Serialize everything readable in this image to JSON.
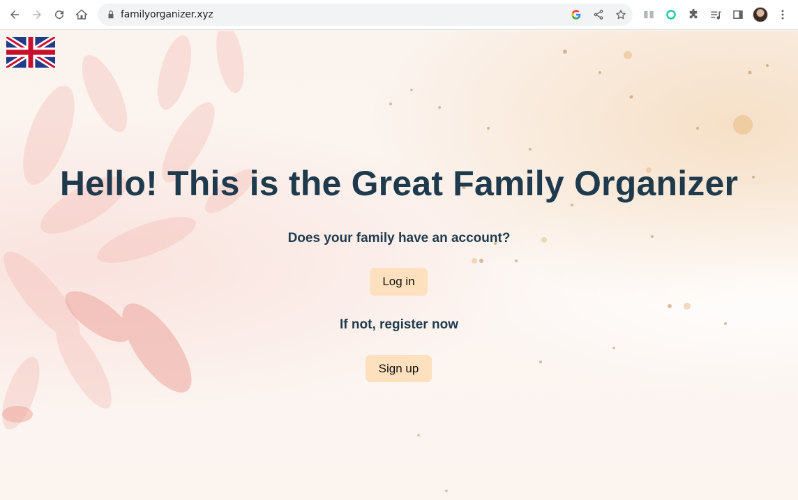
{
  "browser": {
    "url": "familyorganizer.xyz"
  },
  "page": {
    "language_flag": "uk-flag",
    "headline": "Hello! This is the Great Family Organizer",
    "question": "Does your family have an account?",
    "login_label": "Log in",
    "register_prompt": "If not, register now",
    "signup_label": "Sign up"
  },
  "colors": {
    "heading": "#1f3a4d",
    "button_bg": "#fde0bd",
    "background": "#fbf4ef"
  }
}
